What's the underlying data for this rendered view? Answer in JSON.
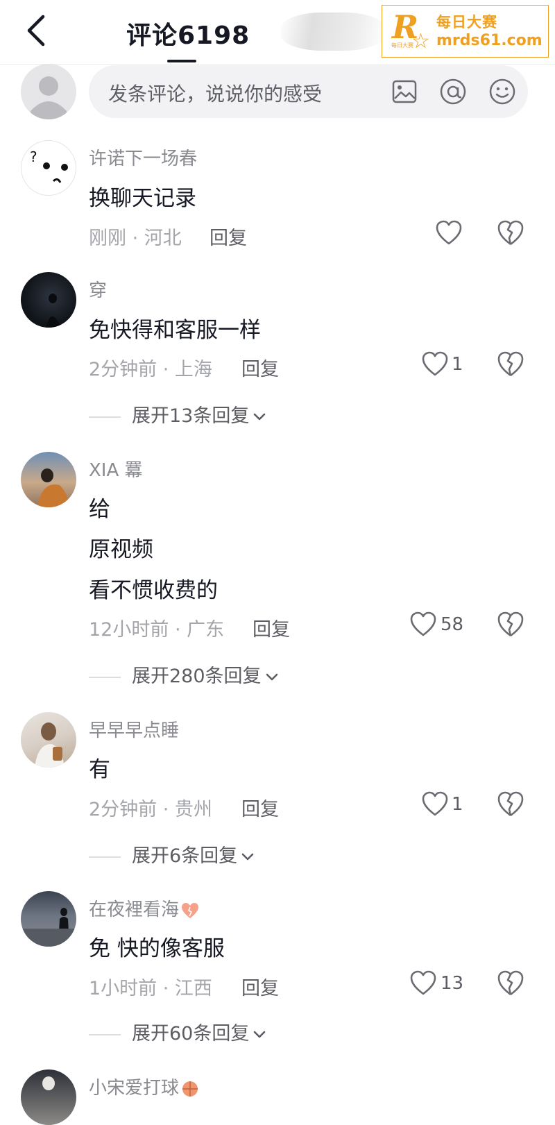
{
  "header": {
    "title": "评论6198",
    "watermark": {
      "r": "R",
      "tiny": "每日大赛",
      "cn": "每日大赛",
      "url": "mrds61.com",
      "color": "#f0a020"
    }
  },
  "input": {
    "placeholder": "发条评论，说说你的感受"
  },
  "reply_label": "回复",
  "comments": [
    {
      "name": "许诺下一场春",
      "lines": [
        "换聊天记录"
      ],
      "time": "刚刚 · 河北",
      "likes": "",
      "expand": ""
    },
    {
      "name": "穿",
      "lines": [
        "免快得和客服一样"
      ],
      "time": "2分钟前 · 上海",
      "likes": "1",
      "expand": "展开13条回复"
    },
    {
      "name": "XIA 羃",
      "lines": [
        "给",
        "原视频",
        "看不惯收费的"
      ],
      "time": "12小时前 · 广东",
      "likes": "58",
      "expand": "展开280条回复"
    },
    {
      "name": "早早早点睡",
      "lines": [
        "有"
      ],
      "time": "2分钟前 · 贵州",
      "likes": "1",
      "expand": "展开6条回复"
    },
    {
      "name": "在夜裡看海",
      "lines": [
        "免 快的像客服"
      ],
      "time": "1小时前 · 江西",
      "likes": "13",
      "expand": "展开60条回复"
    },
    {
      "name": "小宋爱打球",
      "lines": [],
      "time": "",
      "likes": "",
      "expand": ""
    }
  ]
}
